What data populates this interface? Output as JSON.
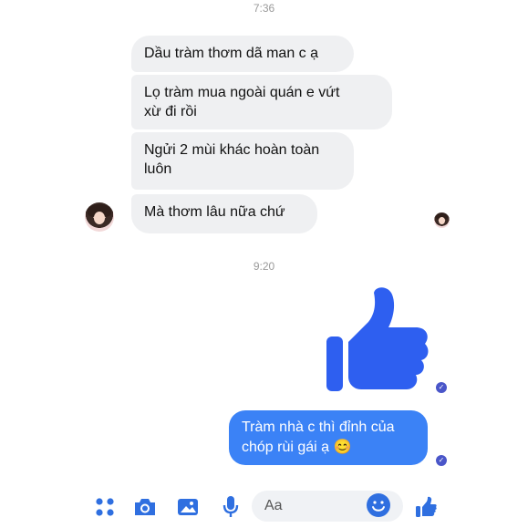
{
  "timestamps": {
    "first": "7:36",
    "second": "9:20"
  },
  "incoming": [
    "Dầu tràm thơm dã man c ạ",
    "Lọ tràm mua ngoài quán e vứt\nxừ đi rồi",
    "Ngửi 2 mùi khác hoàn toàn\nluôn",
    "Mà thơm lâu nữa chứ"
  ],
  "outgoing": {
    "message": "Tràm nhà c thì đỉnh của chóp rùi gái ạ 😊"
  },
  "composer": {
    "placeholder": "Aa",
    "icons": [
      "menu-dots-icon",
      "camera-icon",
      "gallery-icon",
      "microphone-icon",
      "emoji-icon",
      "thumbs-up-icon"
    ]
  },
  "colors": {
    "incoming_bubble": "#eff0f2",
    "outgoing_bubble": "#3b82f6",
    "accent": "#2f6fe0",
    "big_like": "#2e5ff0"
  }
}
